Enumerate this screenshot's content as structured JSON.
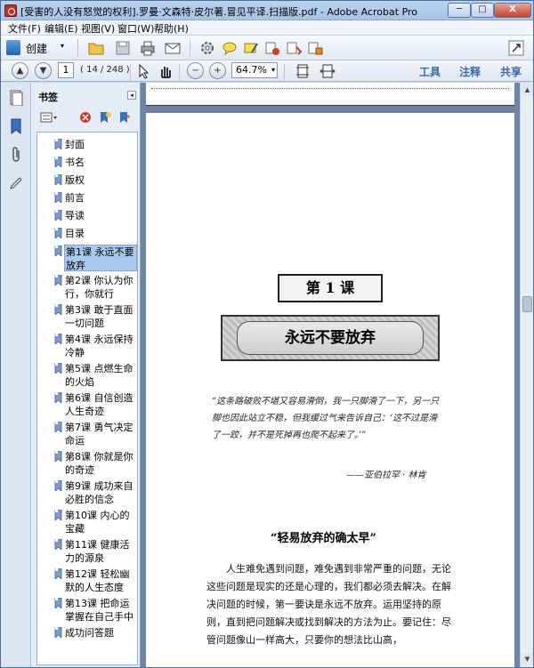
{
  "window": {
    "title": "[受害的人没有怒觉的权利].罗曼·文森特·皮尔著.冒见平译.扫描版.pdf - Adobe Acrobat Pro",
    "min_glyph": "─",
    "max_glyph": "□",
    "close_glyph": "X"
  },
  "menu": [
    "文件(F)",
    "编辑(E)",
    "视图(V)",
    "窗口(W)",
    "帮助(H)"
  ],
  "toolbar": {
    "create_label": "创建",
    "create_caret": "▾",
    "icons": [
      "open-folder-icon",
      "save-icon",
      "print-icon",
      "email-icon",
      "settings-gear-icon",
      "comment-bubble-icon",
      "highlight-icon",
      "delete-comment-icon",
      "attach-icon",
      "stamp-icon",
      "expand-icon"
    ]
  },
  "nav": {
    "prev_glyph": "▲",
    "next_glyph": "▼",
    "page_value": "1",
    "page_count": "( 14 / 248 )",
    "zoom_out_glyph": "−",
    "zoom_in_glyph": "+",
    "zoom_value": "64.7%",
    "zoom_caret": "▾",
    "tools_label": "工具",
    "comment_label": "注释",
    "share_label": "共享"
  },
  "bookmarks": {
    "title": "书签",
    "collapse_glyph": "◂",
    "items": [
      {
        "label": "封面"
      },
      {
        "label": "书名"
      },
      {
        "label": "版权"
      },
      {
        "label": "前言"
      },
      {
        "label": "导读"
      },
      {
        "label": "目录"
      },
      {
        "label": "第1课 永远不要放弃"
      },
      {
        "label": "第2课 你认为你行，你就行"
      },
      {
        "label": "第3课 敢于直面一切问题"
      },
      {
        "label": "第4课 永远保持冷静"
      },
      {
        "label": "第5课 点燃生命的火焰"
      },
      {
        "label": "第6课 自信创造人生奇迹"
      },
      {
        "label": "第7课 勇气决定命运"
      },
      {
        "label": "第8课 你就是你的奇迹"
      },
      {
        "label": "第9课 成功来自必胜的信念"
      },
      {
        "label": "第10课 内心的宝藏"
      },
      {
        "label": "第11课 健康活力的源泉"
      },
      {
        "label": "第12课 轻松幽默的人生态度"
      },
      {
        "label": "第13课 把命运掌握在自己手中"
      },
      {
        "label": "成功问答题"
      }
    ]
  },
  "scroll": {
    "up_glyph": "▲",
    "down_glyph": "▼"
  },
  "page": {
    "lesson": "第 1 课",
    "title": "永远不要放弃",
    "quote": "“这条路破败不堪又容易滑倒，我一只脚滑了一下，另一只脚也因此站立不稳，但我缓过气来告诉自己：‘这不过是滑了一跤，并不是死掉再也爬不起来了。’”",
    "quote_author": "——亚伯拉罕 · 林肯",
    "section_title": "“轻易放弃的确太早”",
    "body": "人生难免遇到问题，难免遇到非常严重的问题，无论这些问题是现实的还是心理的，我们都必须去解决。在解决问题的时候，第一要诀是永远不放弃。运用坚持的原则，直到把问题解决或找到解决的方法为止。要记住：尽管问题像山一样高大，只要你的想法比山高，"
  }
}
